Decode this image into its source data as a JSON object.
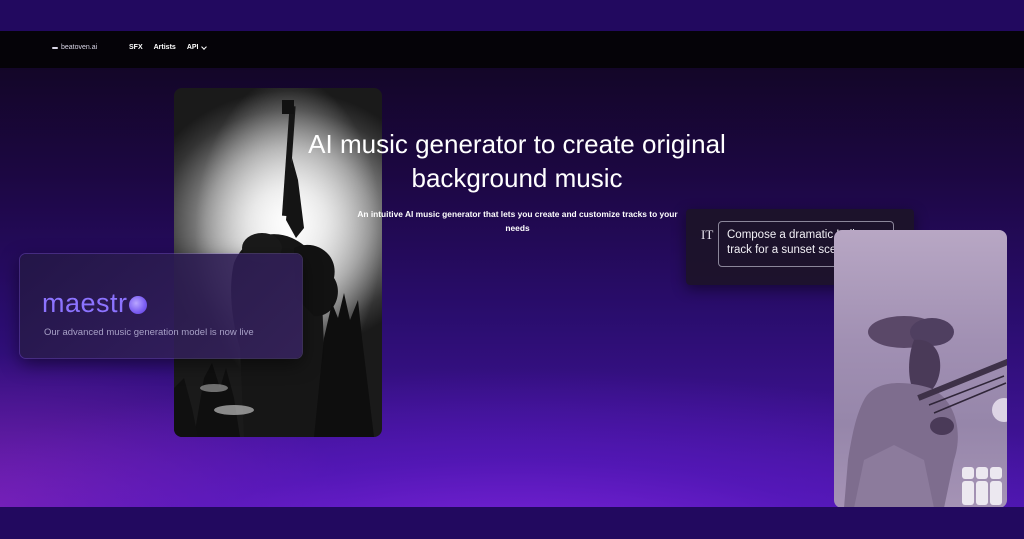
{
  "navbar": {
    "logo_text": "beatoven.ai",
    "links": [
      {
        "label": "SFX"
      },
      {
        "label": "Artists"
      },
      {
        "label": "API"
      }
    ]
  },
  "hero": {
    "title_line1": "AI music generator to create original",
    "title_line2": "background music",
    "subtitle_line1": "An intuitive AI music generator that lets you create and customize tracks to your",
    "subtitle_line2": "needs"
  },
  "maestro_card": {
    "title": "maestr",
    "description": "Our advanced music generation model is now live"
  },
  "prompt_card": {
    "icon_text": "IT",
    "prompt_line1": "Compose a dramatic Indian",
    "prompt_line2": "track for a sunset scene"
  },
  "colors": {
    "accent": "#8c73ff",
    "navbar_bg": "#050308",
    "background_top": "#10061f",
    "background_bottom": "#4a16aa"
  },
  "icons": {
    "maestro_dot": "circle-icon",
    "text_tool": "text-tool-icon",
    "grid": "grid-icon",
    "dropdown": "chevron-down-icon"
  }
}
